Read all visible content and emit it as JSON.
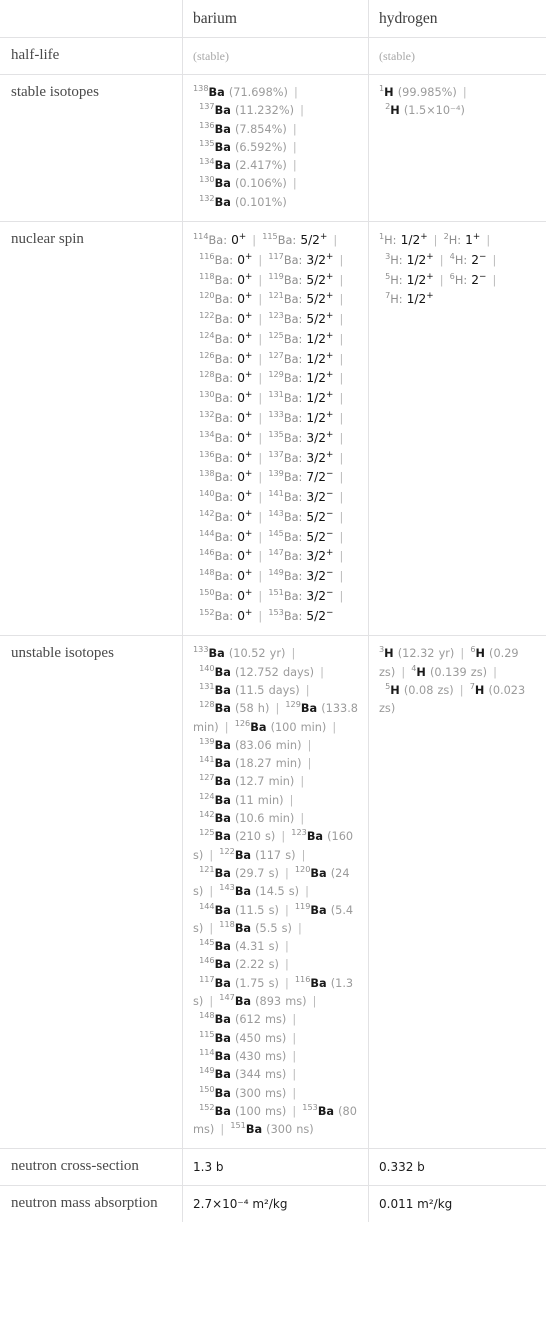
{
  "table": {
    "columns": [
      "",
      "barium",
      "hydrogen"
    ],
    "rows": [
      {
        "label": "half-life",
        "barium": "(stable)",
        "hydrogen": "(stable)"
      },
      {
        "label": "stable isotopes",
        "barium_isotopes": [
          {
            "mass": "138",
            "symbol": "Ba",
            "value": "(71.698%)"
          },
          {
            "mass": "137",
            "symbol": "Ba",
            "value": "(11.232%)"
          },
          {
            "mass": "136",
            "symbol": "Ba",
            "value": "(7.854%)"
          },
          {
            "mass": "135",
            "symbol": "Ba",
            "value": "(6.592%)"
          },
          {
            "mass": "134",
            "symbol": "Ba",
            "value": "(2.417%)"
          },
          {
            "mass": "130",
            "symbol": "Ba",
            "value": "(0.106%)"
          },
          {
            "mass": "132",
            "symbol": "Ba",
            "value": "(0.101%)"
          }
        ],
        "hydrogen_isotopes": [
          {
            "mass": "1",
            "symbol": "H",
            "value": "(99.985%)"
          },
          {
            "mass": "2",
            "symbol": "H",
            "value": "(1.5×10⁻⁴)"
          }
        ]
      },
      {
        "label": "nuclear spin",
        "barium_spins": [
          {
            "mass": "114",
            "symbol": "Ba",
            "spin": "0",
            "parity": "+"
          },
          {
            "mass": "115",
            "symbol": "Ba",
            "spin": "5/2",
            "parity": "+"
          },
          {
            "mass": "116",
            "symbol": "Ba",
            "spin": "0",
            "parity": "+"
          },
          {
            "mass": "117",
            "symbol": "Ba",
            "spin": "3/2",
            "parity": "+"
          },
          {
            "mass": "118",
            "symbol": "Ba",
            "spin": "0",
            "parity": "+"
          },
          {
            "mass": "119",
            "symbol": "Ba",
            "spin": "5/2",
            "parity": "+"
          },
          {
            "mass": "120",
            "symbol": "Ba",
            "spin": "0",
            "parity": "+"
          },
          {
            "mass": "121",
            "symbol": "Ba",
            "spin": "5/2",
            "parity": "+"
          },
          {
            "mass": "122",
            "symbol": "Ba",
            "spin": "0",
            "parity": "+"
          },
          {
            "mass": "123",
            "symbol": "Ba",
            "spin": "5/2",
            "parity": "+"
          },
          {
            "mass": "124",
            "symbol": "Ba",
            "spin": "0",
            "parity": "+"
          },
          {
            "mass": "125",
            "symbol": "Ba",
            "spin": "1/2",
            "parity": "+"
          },
          {
            "mass": "126",
            "symbol": "Ba",
            "spin": "0",
            "parity": "+"
          },
          {
            "mass": "127",
            "symbol": "Ba",
            "spin": "1/2",
            "parity": "+"
          },
          {
            "mass": "128",
            "symbol": "Ba",
            "spin": "0",
            "parity": "+"
          },
          {
            "mass": "129",
            "symbol": "Ba",
            "spin": "1/2",
            "parity": "+"
          },
          {
            "mass": "130",
            "symbol": "Ba",
            "spin": "0",
            "parity": "+"
          },
          {
            "mass": "131",
            "symbol": "Ba",
            "spin": "1/2",
            "parity": "+"
          },
          {
            "mass": "132",
            "symbol": "Ba",
            "spin": "0",
            "parity": "+"
          },
          {
            "mass": "133",
            "symbol": "Ba",
            "spin": "1/2",
            "parity": "+"
          },
          {
            "mass": "134",
            "symbol": "Ba",
            "spin": "0",
            "parity": "+"
          },
          {
            "mass": "135",
            "symbol": "Ba",
            "spin": "3/2",
            "parity": "+"
          },
          {
            "mass": "136",
            "symbol": "Ba",
            "spin": "0",
            "parity": "+"
          },
          {
            "mass": "137",
            "symbol": "Ba",
            "spin": "3/2",
            "parity": "+"
          },
          {
            "mass": "138",
            "symbol": "Ba",
            "spin": "0",
            "parity": "+"
          },
          {
            "mass": "139",
            "symbol": "Ba",
            "spin": "7/2",
            "parity": "−"
          },
          {
            "mass": "140",
            "symbol": "Ba",
            "spin": "0",
            "parity": "+"
          },
          {
            "mass": "141",
            "symbol": "Ba",
            "spin": "3/2",
            "parity": "−"
          },
          {
            "mass": "142",
            "symbol": "Ba",
            "spin": "0",
            "parity": "+"
          },
          {
            "mass": "143",
            "symbol": "Ba",
            "spin": "5/2",
            "parity": "−"
          },
          {
            "mass": "144",
            "symbol": "Ba",
            "spin": "0",
            "parity": "+"
          },
          {
            "mass": "145",
            "symbol": "Ba",
            "spin": "5/2",
            "parity": "−"
          },
          {
            "mass": "146",
            "symbol": "Ba",
            "spin": "0",
            "parity": "+"
          },
          {
            "mass": "147",
            "symbol": "Ba",
            "spin": "3/2",
            "parity": "+"
          },
          {
            "mass": "148",
            "symbol": "Ba",
            "spin": "0",
            "parity": "+"
          },
          {
            "mass": "149",
            "symbol": "Ba",
            "spin": "3/2",
            "parity": "−"
          },
          {
            "mass": "150",
            "symbol": "Ba",
            "spin": "0",
            "parity": "+"
          },
          {
            "mass": "151",
            "symbol": "Ba",
            "spin": "3/2",
            "parity": "−"
          },
          {
            "mass": "152",
            "symbol": "Ba",
            "spin": "0",
            "parity": "+"
          },
          {
            "mass": "153",
            "symbol": "Ba",
            "spin": "5/2",
            "parity": "−"
          }
        ],
        "hydrogen_spins": [
          {
            "mass": "1",
            "symbol": "H",
            "spin": "1/2",
            "parity": "+"
          },
          {
            "mass": "2",
            "symbol": "H",
            "spin": "1",
            "parity": "+"
          },
          {
            "mass": "3",
            "symbol": "H",
            "spin": "1/2",
            "parity": "+"
          },
          {
            "mass": "4",
            "symbol": "H",
            "spin": "2",
            "parity": "−"
          },
          {
            "mass": "5",
            "symbol": "H",
            "spin": "1/2",
            "parity": "+"
          },
          {
            "mass": "6",
            "symbol": "H",
            "spin": "2",
            "parity": "−"
          },
          {
            "mass": "7",
            "symbol": "H",
            "spin": "1/2",
            "parity": "+"
          }
        ]
      },
      {
        "label": "unstable isotopes",
        "barium_unstable": [
          {
            "mass": "133",
            "symbol": "Ba",
            "value": "(10.52 yr)"
          },
          {
            "mass": "140",
            "symbol": "Ba",
            "value": "(12.752 days)"
          },
          {
            "mass": "131",
            "symbol": "Ba",
            "value": "(11.5 days)"
          },
          {
            "mass": "128",
            "symbol": "Ba",
            "value": "(58 h)"
          },
          {
            "mass": "129",
            "symbol": "Ba",
            "value": "(133.8 min)"
          },
          {
            "mass": "126",
            "symbol": "Ba",
            "value": "(100 min)"
          },
          {
            "mass": "139",
            "symbol": "Ba",
            "value": "(83.06 min)"
          },
          {
            "mass": "141",
            "symbol": "Ba",
            "value": "(18.27 min)"
          },
          {
            "mass": "127",
            "symbol": "Ba",
            "value": "(12.7 min)"
          },
          {
            "mass": "124",
            "symbol": "Ba",
            "value": "(11 min)"
          },
          {
            "mass": "142",
            "symbol": "Ba",
            "value": "(10.6 min)"
          },
          {
            "mass": "125",
            "symbol": "Ba",
            "value": "(210 s)"
          },
          {
            "mass": "123",
            "symbol": "Ba",
            "value": "(160 s)"
          },
          {
            "mass": "122",
            "symbol": "Ba",
            "value": "(117 s)"
          },
          {
            "mass": "121",
            "symbol": "Ba",
            "value": "(29.7 s)"
          },
          {
            "mass": "120",
            "symbol": "Ba",
            "value": "(24 s)"
          },
          {
            "mass": "143",
            "symbol": "Ba",
            "value": "(14.5 s)"
          },
          {
            "mass": "144",
            "symbol": "Ba",
            "value": "(11.5 s)"
          },
          {
            "mass": "119",
            "symbol": "Ba",
            "value": "(5.4 s)"
          },
          {
            "mass": "118",
            "symbol": "Ba",
            "value": "(5.5 s)"
          },
          {
            "mass": "145",
            "symbol": "Ba",
            "value": "(4.31 s)"
          },
          {
            "mass": "146",
            "symbol": "Ba",
            "value": "(2.22 s)"
          },
          {
            "mass": "117",
            "symbol": "Ba",
            "value": "(1.75 s)"
          },
          {
            "mass": "116",
            "symbol": "Ba",
            "value": "(1.3 s)"
          },
          {
            "mass": "147",
            "symbol": "Ba",
            "value": "(893 ms)"
          },
          {
            "mass": "148",
            "symbol": "Ba",
            "value": "(612 ms)"
          },
          {
            "mass": "115",
            "symbol": "Ba",
            "value": "(450 ms)"
          },
          {
            "mass": "114",
            "symbol": "Ba",
            "value": "(430 ms)"
          },
          {
            "mass": "149",
            "symbol": "Ba",
            "value": "(344 ms)"
          },
          {
            "mass": "150",
            "symbol": "Ba",
            "value": "(300 ms)"
          },
          {
            "mass": "152",
            "symbol": "Ba",
            "value": "(100 ms)"
          },
          {
            "mass": "153",
            "symbol": "Ba",
            "value": "(80 ms)"
          },
          {
            "mass": "151",
            "symbol": "Ba",
            "value": "(300 ns)"
          }
        ],
        "hydrogen_unstable": [
          {
            "mass": "3",
            "symbol": "H",
            "value": "(12.32 yr)"
          },
          {
            "mass": "6",
            "symbol": "H",
            "value": "(0.29 zs)"
          },
          {
            "mass": "4",
            "symbol": "H",
            "value": "(0.139 zs)"
          },
          {
            "mass": "5",
            "symbol": "H",
            "value": "(0.08 zs)"
          },
          {
            "mass": "7",
            "symbol": "H",
            "value": "(0.023 zs)"
          }
        ]
      },
      {
        "label": "neutron cross-section",
        "barium": "1.3 b",
        "hydrogen": "0.332 b"
      },
      {
        "label": "neutron mass absorption",
        "barium": "2.7×10⁻⁴ m²/kg",
        "hydrogen": "0.011 m²/kg"
      }
    ]
  },
  "colors": {
    "border": "#e2e2e4",
    "text": "#3c3c3c",
    "muted": "#9b9b9b",
    "separator": "#b9b9b9"
  }
}
